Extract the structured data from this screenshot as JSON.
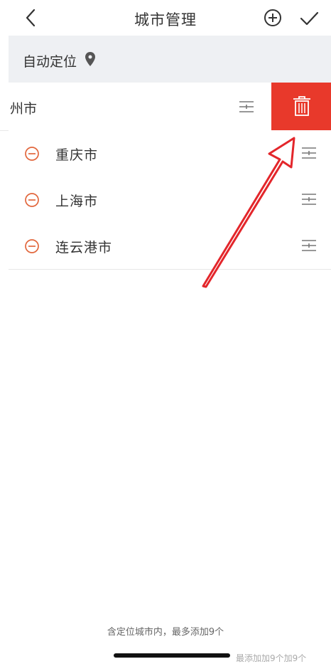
{
  "header": {
    "title": "城市管理",
    "back_icon": "chevron-left-icon",
    "add_icon": "plus-circle-icon",
    "done_icon": "checkmark-icon"
  },
  "location_section": {
    "label": "自动定位",
    "icon": "location-pin-icon"
  },
  "swiped_row": {
    "name": "州市",
    "delete_icon": "trash-icon",
    "delete_color": "#e8392b"
  },
  "cities": [
    {
      "name": "重庆市"
    },
    {
      "name": "上海市"
    },
    {
      "name": "连云港市"
    }
  ],
  "footer": {
    "note": "含定位城市内，最多添加9个",
    "ghost": "最添加加9个加9个"
  },
  "colors": {
    "accent_red": "#e8392b",
    "remove_orange": "#e2673d",
    "arrow_red": "#e3262b"
  }
}
